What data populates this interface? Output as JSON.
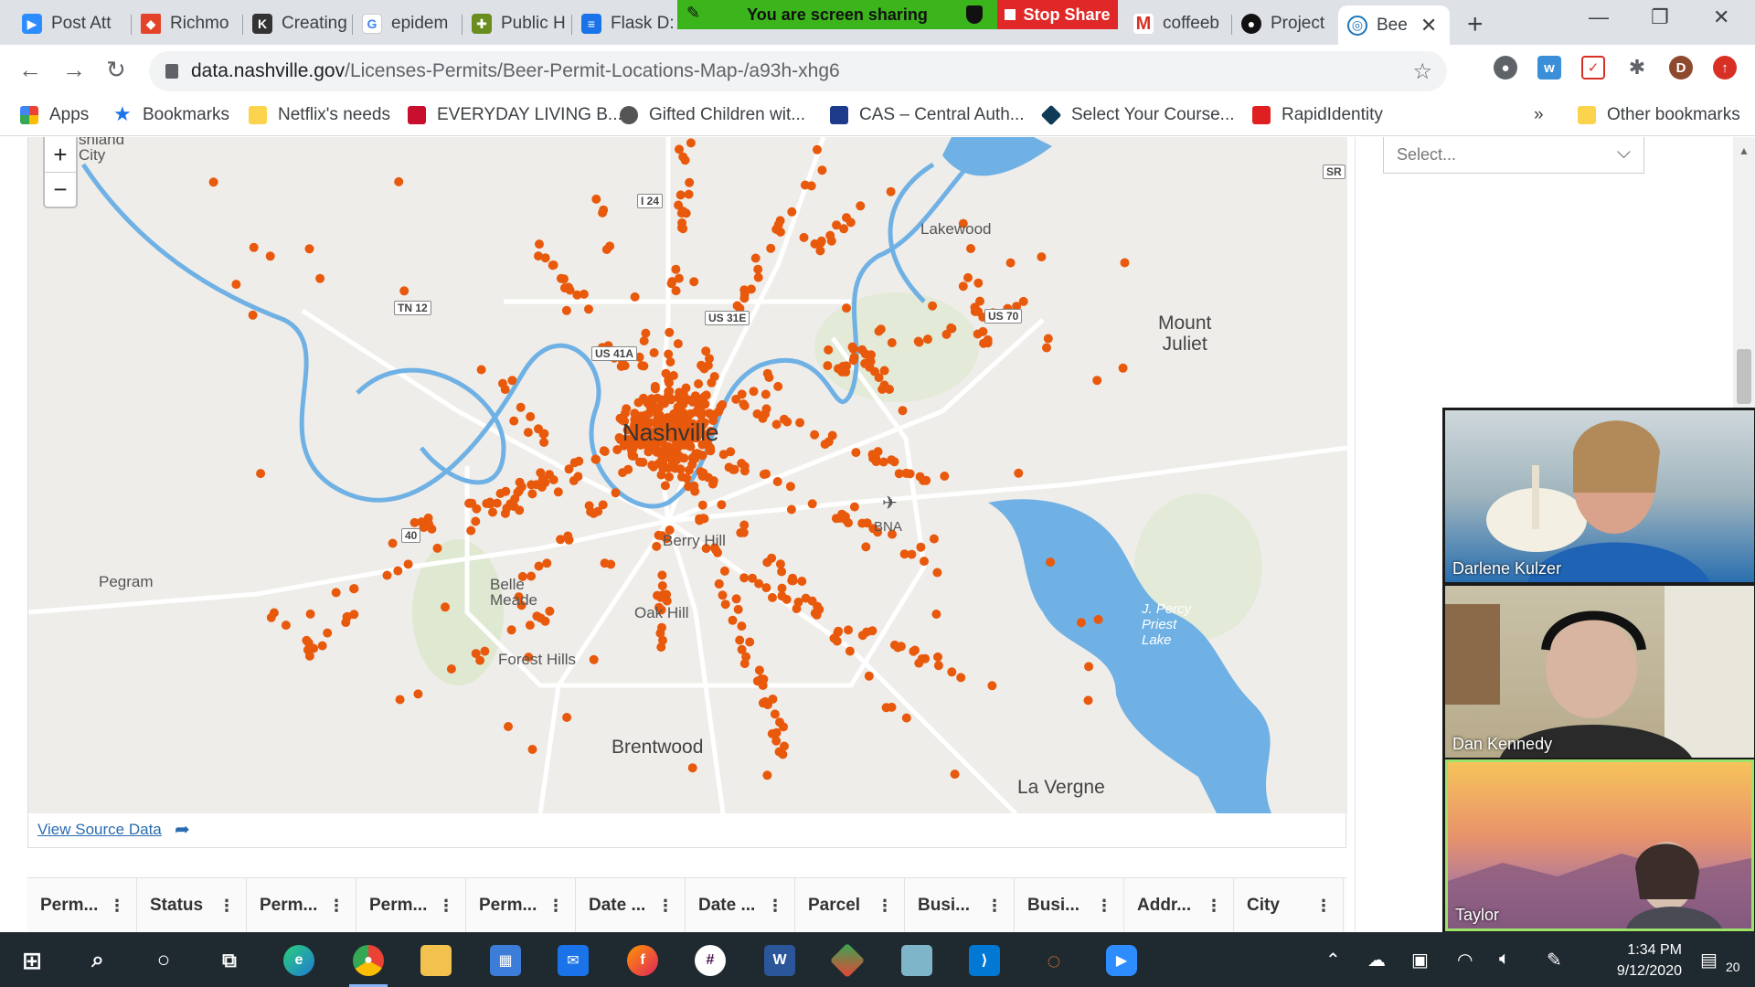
{
  "tabs": [
    {
      "title": "Post Att",
      "icon": "zoom-icon",
      "color": "#2d8cff"
    },
    {
      "title": "Richmo",
      "icon": "gitlab-icon",
      "color": "#e24329"
    },
    {
      "title": "Creating",
      "icon": "ck-icon",
      "color": "#333333"
    },
    {
      "title": "epidem",
      "icon": "google-icon",
      "color": "#4285f4"
    },
    {
      "title": "Public H",
      "icon": "public-health-icon",
      "color": "#6a8d1f"
    },
    {
      "title": "Flask D:",
      "icon": "document-icon",
      "color": "#1a73e8"
    },
    {
      "title": "coffeeb",
      "icon": "gmail-icon",
      "color": "#d93025"
    },
    {
      "title": "Project",
      "icon": "github-icon",
      "color": "#111111"
    },
    {
      "title": "Bee",
      "icon": "socrata-icon",
      "color": "#1b76bb"
    }
  ],
  "sharing": {
    "banner": "You are screen sharing",
    "stop_label": "Stop Share"
  },
  "address": {
    "domain": "data.nashville.gov",
    "path": "/Licenses-Permits/Beer-Permit-Locations-Map-/a93h-xhg6"
  },
  "profile_initial": "D",
  "bookmarks": {
    "apps": "Apps",
    "items": [
      "Bookmarks",
      "Netflix's needs",
      "EVERYDAY LIVING B...",
      "Gifted Children wit...",
      "CAS – Central Auth...",
      "Select Your Course...",
      "RapidIdentity"
    ],
    "more": "»",
    "other": "Other bookmarks"
  },
  "map": {
    "labels": {
      "ashland": "shland\nCity",
      "lakewood": "Lakewood",
      "mount_juliet": "Mount\nJuliet",
      "nashville": "Nashville",
      "berry_hill": "Berry Hill",
      "bna": "BNA",
      "pegram": "Pegram",
      "belle_meade": "Belle\nMeade",
      "oak_hill": "Oak Hill",
      "forest_hills": "Forest Hills",
      "percy_priest": "J. Percy\nPriest\nLake",
      "brentwood": "Brentwood",
      "la_vergne": "La Vergne"
    },
    "shields": {
      "i24": "I 24",
      "tn12": "TN 12",
      "us31e": "US 31E",
      "us41a": "US 41A",
      "us70": "US 70",
      "i40": "40",
      "sr": "SR"
    },
    "zoom_in": "+",
    "zoom_out": "−",
    "dot_color": "#e8590c",
    "water_color": "#6fb1e4"
  },
  "view_source": "View Source Data",
  "filter_select": {
    "placeholder": "Select..."
  },
  "table_headers": [
    "Perm...",
    "Status",
    "Perm...",
    "Perm...",
    "Perm...",
    "Date ...",
    "Date ...",
    "Parcel",
    "Busi...",
    "Busi...",
    "Addr...",
    "City"
  ],
  "participants": [
    {
      "name": "Darlene Kulzer"
    },
    {
      "name": "Dan Kennedy"
    },
    {
      "name": "Taylor"
    }
  ],
  "clock": {
    "time": "1:34 PM",
    "date": "9/12/2020"
  },
  "notifications": "20"
}
